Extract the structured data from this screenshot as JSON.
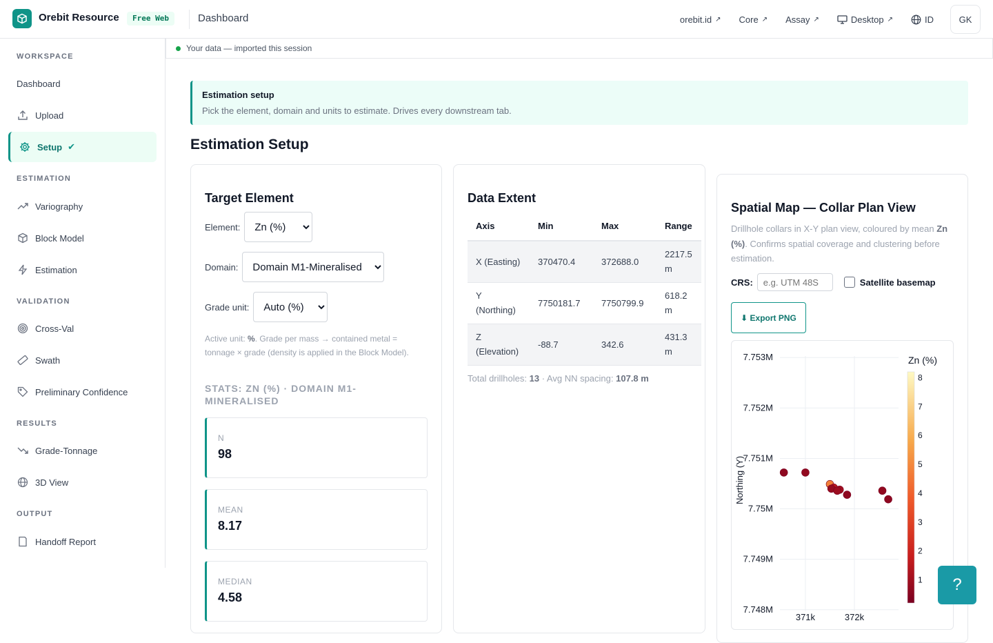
{
  "topbar": {
    "brand": "Orebit Resource",
    "badge": "Free Web",
    "title": "Dashboard",
    "links": [
      {
        "label": "orebit.id",
        "arrow": "↗"
      },
      {
        "label": "Core",
        "arrow": "↗"
      },
      {
        "label": "Assay",
        "arrow": "↗"
      },
      {
        "label": "Desktop",
        "arrow": "↗"
      },
      {
        "label": "ID",
        "arrow": ""
      }
    ],
    "avatar": "GK"
  },
  "sidebar": {
    "sections": [
      "WORKSPACE",
      "ESTIMATION",
      "VALIDATION",
      "RESULTS",
      "OUTPUT"
    ],
    "items": [
      {
        "label": "Dashboard"
      },
      {
        "label": "Upload"
      },
      {
        "label": "Setup",
        "check": "✔"
      },
      {
        "label": "Variography"
      },
      {
        "label": "Block Model"
      },
      {
        "label": "Estimation"
      },
      {
        "label": "Cross-Val"
      },
      {
        "label": "Swath"
      },
      {
        "label": "Preliminary Confidence"
      },
      {
        "label": "Grade-Tonnage"
      },
      {
        "label": "3D View"
      },
      {
        "label": "Handoff Report"
      }
    ]
  },
  "databar": {
    "text": "Your data — imported this session"
  },
  "infobox": {
    "title": "Estimation setup",
    "text": "Pick the element, domain and units to estimate. Drives every downstream tab."
  },
  "page_title": "Estimation Setup",
  "target": {
    "title": "Target Element",
    "element_label": "Element:",
    "element_value": "Zn (%)",
    "domain_label": "Domain:",
    "domain_value": "Domain M1-Mineralised",
    "unit_label": "Grade unit:",
    "unit_value": "Auto (%)",
    "note_prefix": "Active unit: ",
    "note_unit": "%",
    "note_rest": ". Grade per mass → contained metal = tonnage × grade (density is applied in the Block Model).",
    "stats_title": "STATS: ZN (%) · DOMAIN M1-MINERALISED",
    "stats": [
      {
        "label": "N",
        "value": "98"
      },
      {
        "label": "MEAN",
        "value": "8.17"
      },
      {
        "label": "MEDIAN",
        "value": "4.58"
      }
    ]
  },
  "extent": {
    "title": "Data Extent",
    "headers": [
      "Axis",
      "Min",
      "Max",
      "Range"
    ],
    "rows": [
      {
        "axis": "X (Easting)",
        "min": "370470.4",
        "max": "372688.0",
        "range": "2217.5 m"
      },
      {
        "axis": "Y (Northing)",
        "min": "7750181.7",
        "max": "7750799.9",
        "range": "618.2 m"
      },
      {
        "axis": "Z (Elevation)",
        "min": "-88.7",
        "max": "342.6",
        "range": "431.3 m"
      }
    ],
    "foot_a": "Total drillholes: ",
    "foot_b": "13",
    "foot_c": " · Avg NN spacing: ",
    "foot_d": "107.8 m"
  },
  "map": {
    "title": "Spatial Map — Collar Plan View",
    "desc_a": "Drillhole collars in X-Y plan view, coloured by mean ",
    "desc_b": "Zn (%)",
    "desc_c": ". Confirms spatial coverage and clustering before estimation.",
    "crs_label": "CRS:",
    "crs_placeholder": "e.g. UTM 48S",
    "basemap_label": "Satellite basemap",
    "export_label": "⬇ Export PNG"
  },
  "chart_data": {
    "type": "scatter",
    "title": "",
    "xlabel": "",
    "ylabel": "Northing (Y)",
    "colorbar_title": "Zn (%)",
    "colorbar_ticks": [
      1,
      2,
      3,
      4,
      5,
      6,
      7,
      8
    ],
    "colorbar_range": [
      0.2,
      8.2
    ],
    "xlim": [
      370480,
      372900
    ],
    "ylim": [
      7747970,
      7753030
    ],
    "x_ticks": [
      {
        "value": 371000,
        "label": "371k"
      },
      {
        "value": 372000,
        "label": "372k"
      }
    ],
    "y_ticks": [
      {
        "value": 7748000,
        "label": "7.748M"
      },
      {
        "value": 7749000,
        "label": "7.749M"
      },
      {
        "value": 7750000,
        "label": "7.75M"
      },
      {
        "value": 7751000,
        "label": "7.751M"
      },
      {
        "value": 7752000,
        "label": "7.752M"
      },
      {
        "value": 7753000,
        "label": "7.753M"
      }
    ],
    "grid": true,
    "points": [
      {
        "x": 370560,
        "y": 7750720,
        "z": 0.6
      },
      {
        "x": 371000,
        "y": 7750720,
        "z": 0.7
      },
      {
        "x": 371500,
        "y": 7750490,
        "z": 4.8
      },
      {
        "x": 371580,
        "y": 7750420,
        "z": 1.5
      },
      {
        "x": 371530,
        "y": 7750400,
        "z": 0.8
      },
      {
        "x": 371700,
        "y": 7750380,
        "z": 1.0
      },
      {
        "x": 371650,
        "y": 7750360,
        "z": 0.9
      },
      {
        "x": 371850,
        "y": 7750280,
        "z": 0.6
      },
      {
        "x": 372570,
        "y": 7750360,
        "z": 0.7
      },
      {
        "x": 372690,
        "y": 7750190,
        "z": 0.6
      }
    ]
  },
  "colors": {
    "accent": "#0f9488",
    "accent_dark": "#0f766e",
    "help": "#1a9aa6"
  },
  "help_label": "?"
}
